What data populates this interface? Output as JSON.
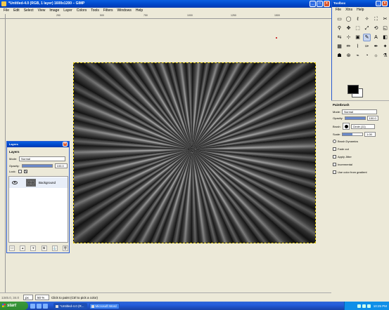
{
  "main_window": {
    "title": "*Untitled-4.0 (RGB, 1 layer) 1600x1200 – GIMP",
    "buttons": [
      "_",
      "□",
      "×"
    ],
    "menu": [
      "File",
      "Edit",
      "Select",
      "View",
      "Image",
      "Layer",
      "Colors",
      "Tools",
      "Filters",
      "Windows",
      "Help"
    ],
    "ruler_labels": [
      "250",
      "500",
      "750",
      "1000",
      "1250",
      "1500"
    ]
  },
  "statusbar": {
    "coords": "1345.0, 34.0",
    "unit": "px",
    "zoom": "50 %",
    "message": "Click to paint (Ctrl to pick a color)"
  },
  "layers": {
    "window_title": "Layers",
    "heading": "Layers",
    "mode_label": "Mode:",
    "mode_value": "Normal",
    "opacity_label": "Opacity:",
    "opacity_value": "100.0",
    "lock_label": "Lock:",
    "layer_name": "Background",
    "buttons": [
      "☐",
      "▲",
      "▼",
      "⧉",
      "⚓",
      "🗑"
    ]
  },
  "toolbox": {
    "title": "Toolbox",
    "menu": [
      "File",
      "Xtns",
      "Help"
    ],
    "tools": [
      "▭",
      "◯",
      "ℓ",
      "✧",
      "⛶",
      "✂",
      "⚲",
      "✥",
      "⬚",
      "⤢",
      "⟲",
      "◱",
      "⇆",
      "⊹",
      "▣",
      "✎",
      "A",
      "◧",
      "▦",
      "✏",
      "⌇",
      "✑",
      "✒",
      "✦",
      "☗",
      "⊛",
      "⌁",
      "◔",
      "☼",
      "⚗"
    ],
    "active_tool_index": 15
  },
  "tool_options": {
    "title": "Paintbrush",
    "mode_label": "Mode:",
    "mode_value": "Normal",
    "opacity_label": "Opacity:",
    "opacity_value": "100.0",
    "opacity_fraction": 1.0,
    "brush_label": "Brush:",
    "brush_value": "Circle (11)",
    "scale_label": "Scale:",
    "scale_value": "1.00",
    "scale_fraction": 0.5,
    "brush_dynamics": "Brush Dynamics",
    "options": [
      "Fade out",
      "Apply Jitter",
      "Incremental",
      "Use color from gradient"
    ]
  },
  "taskbar": {
    "start": "start",
    "tasks": [
      "*Untitled-4.0 (R...",
      "Microsoft Word"
    ],
    "clock": "10:25 PM"
  }
}
